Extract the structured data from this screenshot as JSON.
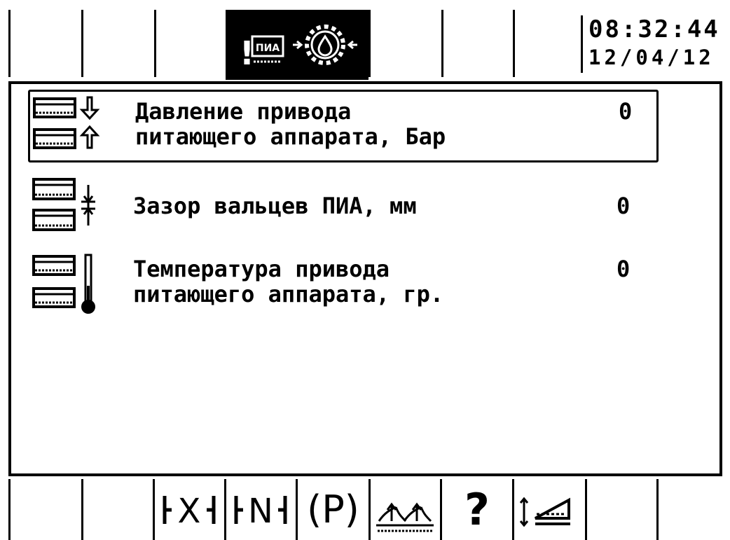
{
  "header": {
    "alarm_mark": "!",
    "alarm_tag": "ПИА",
    "time": "08:32:44",
    "date": "12/04/12"
  },
  "params": [
    {
      "label_line1": "Давление привода",
      "label_line2": "питающего аппарата, Бар",
      "value": "0",
      "icon": "roller-pressure-icon"
    },
    {
      "label_line1": "Зазор вальцев ПИА, мм",
      "label_line2": "",
      "value": "0",
      "icon": "roller-gap-icon"
    },
    {
      "label_line1": "Температура привода",
      "label_line2": "питающего аппарата, гр.",
      "value": "0",
      "icon": "roller-temperature-icon"
    }
  ],
  "softkeys": {
    "x_key": "X",
    "n_key": "N",
    "p_key": "(P)",
    "help_key": "?"
  }
}
